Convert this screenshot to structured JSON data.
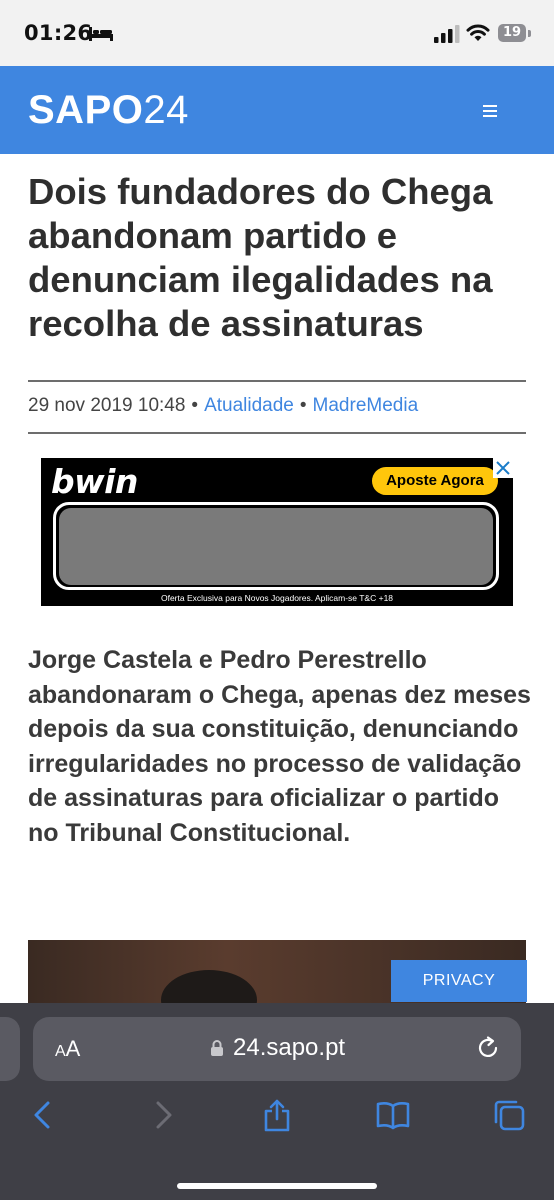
{
  "status_bar": {
    "time": "01:26",
    "battery_level": "19",
    "icons": [
      "sleep-bed-icon",
      "cellular-signal-icon",
      "wifi-icon",
      "battery-icon"
    ]
  },
  "header": {
    "logo_bold": "SAPO",
    "logo_light": "24",
    "menu_icon": "hamburger-menu-icon",
    "color": "#3f86e0"
  },
  "article": {
    "title": "Dois fundadores do Chega abandonam partido e denunciam ilegalidades na recolha de assinaturas",
    "date": "29 nov 2019 10:48",
    "separator": "•",
    "category": "Atualidade",
    "source": "MadreMedia",
    "lead": "Jorge Castela e Pedro Perestrello abandonaram o Chega, apenas dez meses depois da sua constituição, denunciando irregularidades no processo de validação de assinaturas para oficializar o partido no Tribunal Constitucional."
  },
  "ad": {
    "brand": "bwin",
    "cta": "Aposte Agora",
    "disclaimer": "Oferta Exclusiva para Novos Jogadores. Aplicam-se T&C +18",
    "cta_color": "#ffc60b"
  },
  "privacy_button": "PRIVACY",
  "browser": {
    "text_size_label_small": "A",
    "text_size_label_large": "A",
    "url": "24.sapo.pt",
    "toolbar_icons": [
      "back-icon",
      "forward-icon",
      "share-icon",
      "bookmarks-icon",
      "tabs-icon"
    ]
  }
}
